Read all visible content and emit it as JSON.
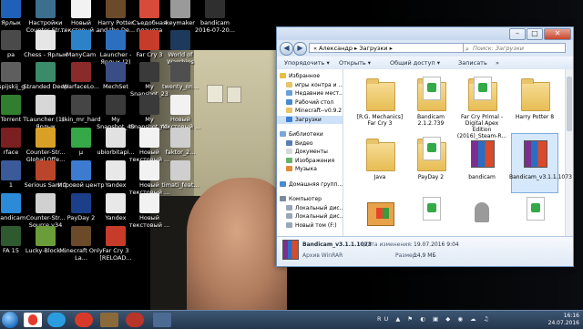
{
  "desktop_icons": [
    {
      "label": "Ярлык",
      "color": "#1f60b8"
    },
    {
      "label": "Настройки Counter-Str...",
      "color": "#3c6e8e"
    },
    {
      "label": "Новый текстовый ...",
      "color": "#f2f2f2"
    },
    {
      "label": "Harry Potter and the De...",
      "color": "#6b4a2a"
    },
    {
      "label": "Съедобная планета",
      "color": "#d84b3a"
    },
    {
      "label": "keymaker",
      "color": "#9a9a9a"
    },
    {
      "label": "bandicam 2016-07-20...",
      "color": "#2f2f2f"
    },
    {
      "label": "ра",
      "color": "#4a4a4a"
    },
    {
      "label": "Chess - Ярлык",
      "color": "#e6e6e6"
    },
    {
      "label": "ManyCam",
      "color": "#2c82c9"
    },
    {
      "label": "Launcher - Ярлык (2)",
      "color": "#2d6fbf"
    },
    {
      "label": "Far Cry 3",
      "color": "#c73b2a"
    },
    {
      "label": "World of Warships",
      "color": "#1d3a5a"
    },
    {
      "label": "kaspijskij_g...",
      "color": "#5e5e5e"
    },
    {
      "label": "Stranded Deep",
      "color": "#3b8a6a"
    },
    {
      "label": "WarfaceLo...",
      "color": "#8b2a2a"
    },
    {
      "label": "MechSet",
      "color": "#3a4e86"
    },
    {
      "label": "My Snapshot_23",
      "color": "#3a3a3a"
    },
    {
      "label": "twenty_on...",
      "color": "#4f4f4f"
    },
    {
      "label": "Torrent",
      "color": "#2f7f2f"
    },
    {
      "label": "TLauncher (1) - Ярлык",
      "color": "#d7d7d7"
    },
    {
      "label": "skin_mr_hard",
      "color": "#454545"
    },
    {
      "label": "My Snapshot_40",
      "color": "#3a3a3a"
    },
    {
      "label": "rface",
      "color": "#7a2020"
    },
    {
      "label": "Counter-Str... Global Offe...",
      "color": "#d9a028"
    },
    {
      "label": "µ",
      "color": "#35a847"
    },
    {
      "label": "ubiorbitapi...",
      "color": "#e1e1e1"
    },
    {
      "label": "My Snapshot_41",
      "color": "#3a3a3a"
    },
    {
      "label": "Новый текстовый ...",
      "color": "#f2f2f2"
    },
    {
      "label": "1",
      "color": "#3a5a9a"
    },
    {
      "label": "Serious Sam 2",
      "color": "#b9452b"
    },
    {
      "label": "Игровой центр",
      "color": "#3c7bd0"
    },
    {
      "label": "Yandex",
      "color": "#e8e8e8"
    },
    {
      "label": "Bandicam",
      "color": "#2b8bd8"
    },
    {
      "label": "Новый текстовый ...",
      "color": "#f2f2f2"
    },
    {
      "label": "Counter-Str... Source v34",
      "color": "#d0d0d0"
    },
    {
      "label": "PayDay 2",
      "color": "#1c3f8a"
    },
    {
      "label": "Yandex",
      "color": "#e8e8e8"
    },
    {
      "label": "Новый текстовый ...",
      "color": "#f2f2f2"
    },
    {
      "label": "faktor_2...",
      "color": "#cfcfcf"
    },
    {
      "label": "FA 15",
      "color": "#2f5a2f"
    },
    {
      "label": "Lucky-Block...",
      "color": "#6b9c3a"
    },
    {
      "label": "Minecraft Only La...",
      "color": "#6b4a2a"
    },
    {
      "label": "Far Cry 3 [RELOAD...",
      "color": "#c73b2a"
    },
    {
      "label": "Новый текстовый ...",
      "color": "#f2f2f2"
    },
    {
      "label": "timati_feat...",
      "color": "#cfcfcf"
    }
  ],
  "window": {
    "address": "« Александр ▸ Загрузки ▸",
    "search_placeholder": "Поиск: Загрузки",
    "toolbar": [
      "Упорядочить ▾",
      "Открыть ▾",
      "Общий доступ ▾",
      "Записать",
      "»"
    ],
    "nav": [
      {
        "label": "Избранное",
        "color": "#e8c040",
        "indent": 0
      },
      {
        "label": "игры контра и ...",
        "color": "#e8c46a",
        "indent": 1
      },
      {
        "label": "Недавние мест...",
        "color": "#6a9fd8",
        "indent": 1
      },
      {
        "label": "Рабочий стол",
        "color": "#4a8ad0",
        "indent": 1
      },
      {
        "label": "Minecraft--v0.9.2",
        "color": "#e8c46a",
        "indent": 1
      },
      {
        "label": "Загрузки",
        "color": "#3d7fd0",
        "indent": 1,
        "selected": true
      },
      {
        "label": "Библиотеки",
        "color": "#7aa6d8",
        "indent": 0
      },
      {
        "label": "Видео",
        "color": "#5a7fb0",
        "indent": 1
      },
      {
        "label": "Документы",
        "color": "#d8d8d8",
        "indent": 1
      },
      {
        "label": "Изображения",
        "color": "#6ab06a",
        "indent": 1
      },
      {
        "label": "Музыка",
        "color": "#e08a3a",
        "indent": 1
      },
      {
        "label": "Домашняя групп...",
        "color": "#4a8ad0",
        "indent": 0
      },
      {
        "label": "Компьютер",
        "color": "#7a8aa0",
        "indent": 0
      },
      {
        "label": "Локальный дис...",
        "color": "#9aa6b6",
        "indent": 1
      },
      {
        "label": "Локальный дис...",
        "color": "#9aa6b6",
        "indent": 1
      },
      {
        "label": "Новый том (F:)",
        "color": "#9aa6b6",
        "indent": 1
      }
    ],
    "files": [
      {
        "name": "[R.G. Mechanics] Far Cry 3",
        "kind": "folder"
      },
      {
        "name": "Bandicam 2.1.2.739",
        "kind": "folder-doc"
      },
      {
        "name": "Far Cry Primal - Digital Apex Edition (2016)_Steam-R...",
        "kind": "folder-doc"
      },
      {
        "name": "Harry Potter 8",
        "kind": "folder"
      },
      {
        "name": "Java",
        "kind": "folder"
      },
      {
        "name": "PayDay 2",
        "kind": "folder-doc"
      },
      {
        "name": "bandicam",
        "kind": "rar"
      },
      {
        "name": "Bandicam_v3.1.1.1073",
        "kind": "rar",
        "selected": true
      },
      {
        "name": "",
        "kind": "setup"
      },
      {
        "name": "",
        "kind": "torrent"
      },
      {
        "name": "",
        "kind": "ghost"
      },
      {
        "name": "",
        "kind": "torrent"
      }
    ],
    "status": {
      "name": "Bandicam_v3.1.1.1073",
      "type": "Архив WinRAR",
      "modified_label": "Дата изменения:",
      "modified_value": "19.07.2016 9:04",
      "size_label": "Размер:",
      "size_value": "14,9 МБ"
    }
  },
  "taskbar": {
    "lang": "RU",
    "time": "16:16",
    "date": "24.07.2016"
  }
}
